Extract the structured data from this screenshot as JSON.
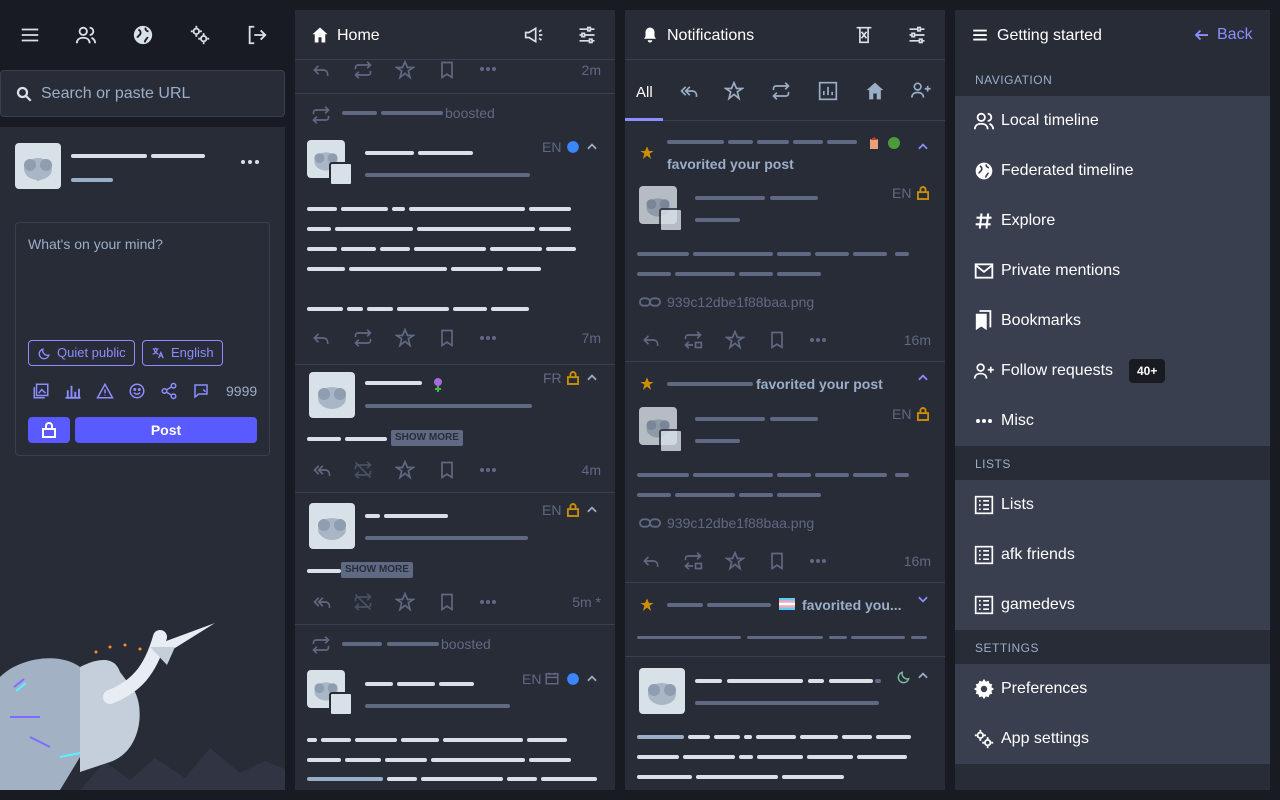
{
  "colors": {
    "background": "#191b22",
    "column": "#282c37",
    "nav_panel": "#393f4f",
    "accent": "#8c8dff",
    "button": "#595aff",
    "muted": "#606984",
    "star": "#ca8f04",
    "lock": "#ca8f04"
  },
  "nav_bar": {
    "icons": [
      "menu-icon",
      "people-icon",
      "globe-icon",
      "gears-icon",
      "logout-icon"
    ]
  },
  "search": {
    "placeholder": "Search or paste URL"
  },
  "compose": {
    "placeholder": "What's on your mind?",
    "visibility_label": "Quiet public",
    "language_label": "English",
    "char_count": "9999",
    "post_label": "Post"
  },
  "home": {
    "title": "Home",
    "posts": [
      {
        "time": "2m"
      },
      {
        "boosted": "boosted",
        "lang": "EN",
        "time": "7m"
      },
      {
        "lang": "FR",
        "show_more": "SHOW MORE",
        "time": "4m"
      },
      {
        "lang": "EN",
        "show_more": "SHOW MORE",
        "time": "5m *"
      },
      {
        "boosted": "boosted",
        "lang": "EN"
      }
    ]
  },
  "notifications": {
    "title": "Notifications",
    "tab_all": "All",
    "items": [
      {
        "action": "favorited your post",
        "lang": "EN",
        "file": "939c12dbe1f88baa.png",
        "time": "16m"
      },
      {
        "action": "favorited your post",
        "lang": "EN",
        "file": "939c12dbe1f88baa.png",
        "time": "16m"
      },
      {
        "action": "favorited you..."
      }
    ]
  },
  "getting_started": {
    "title": "Getting started",
    "back_label": "Back",
    "nav_section": "NAVIGATION",
    "nav_items": [
      {
        "label": "Local timeline",
        "icon": "people-icon"
      },
      {
        "label": "Federated timeline",
        "icon": "globe-icon"
      },
      {
        "label": "Explore",
        "icon": "hashtag-icon"
      },
      {
        "label": "Private mentions",
        "icon": "mail-icon"
      },
      {
        "label": "Bookmarks",
        "icon": "bookmarks-icon"
      },
      {
        "label": "Follow requests",
        "icon": "person-add-icon",
        "badge": "40+"
      },
      {
        "label": "Misc",
        "icon": "ellipsis-icon"
      }
    ],
    "lists_section": "LISTS",
    "list_items": [
      {
        "label": "Lists"
      },
      {
        "label": "afk friends"
      },
      {
        "label": "gamedevs"
      }
    ],
    "settings_section": "SETTINGS",
    "settings_items": [
      {
        "label": "Preferences",
        "icon": "gear-icon"
      },
      {
        "label": "App settings",
        "icon": "gears-icon"
      }
    ]
  }
}
